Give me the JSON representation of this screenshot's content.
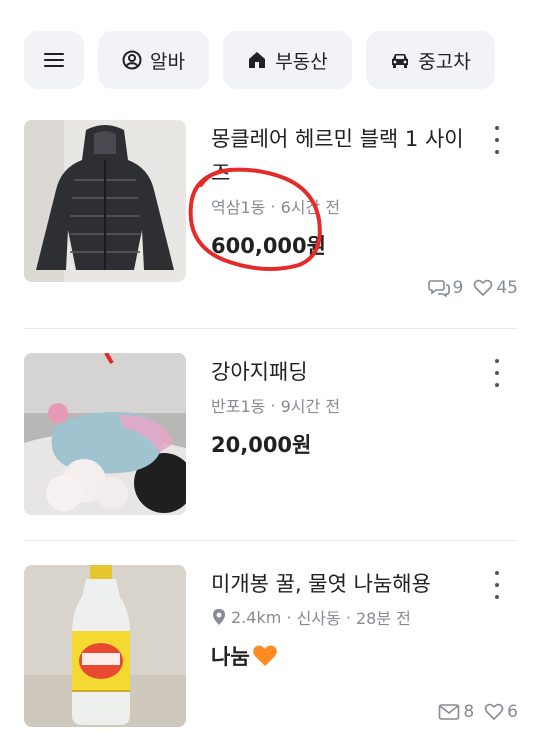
{
  "chips": {
    "menu_icon": "hamburger-menu-icon",
    "alba": "알바",
    "realty": "부동산",
    "car": "중고차"
  },
  "items": [
    {
      "title": "몽클레어 헤르민 블랙 1 사이즈",
      "location": "역삼1동",
      "time": "6시간 전",
      "price": "600,000원",
      "chats": "9",
      "likes": "45"
    },
    {
      "title": "강아지패딩",
      "location": "반포1동",
      "time": "9시간 전",
      "price": "20,000원"
    },
    {
      "title": "미개봉 꿀, 물엿 나눔해용",
      "distance": "2.4km",
      "location": "신사동",
      "time": "28분 전",
      "price": "나눔",
      "mails": "8",
      "likes": "6"
    }
  ],
  "colors": {
    "annotation": "#e52a2a",
    "heart": "#ff8a1f",
    "muted": "#868b94"
  }
}
